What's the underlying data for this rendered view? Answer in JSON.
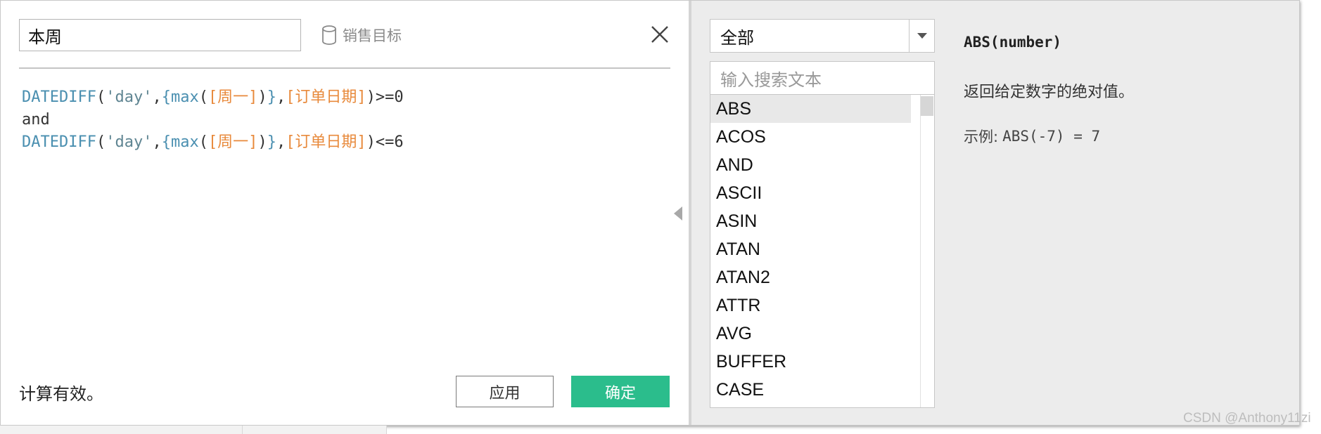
{
  "calc": {
    "name_value": "本周",
    "datasource_label": "销售目标",
    "status_text": "计算有效。",
    "apply_label": "应用",
    "ok_label": "确定",
    "formula": [
      [
        {
          "t": "DATEDIFF",
          "c": "fn"
        },
        {
          "t": "(",
          "c": "plain"
        },
        {
          "t": "'day'",
          "c": "str"
        },
        {
          "t": ",",
          "c": "plain"
        },
        {
          "t": "{max",
          "c": "fn"
        },
        {
          "t": "(",
          "c": "plain"
        },
        {
          "t": "[周一]",
          "c": "fld"
        },
        {
          "t": ")",
          "c": "plain"
        },
        {
          "t": "}",
          "c": "fn"
        },
        {
          "t": ",",
          "c": "plain"
        },
        {
          "t": "[订单日期]",
          "c": "fld"
        },
        {
          "t": ")>=0",
          "c": "plain"
        }
      ],
      [
        {
          "t": "and",
          "c": "plain"
        }
      ],
      [
        {
          "t": "DATEDIFF",
          "c": "fn"
        },
        {
          "t": "(",
          "c": "plain"
        },
        {
          "t": "'day'",
          "c": "str"
        },
        {
          "t": ",",
          "c": "plain"
        },
        {
          "t": "{max",
          "c": "fn"
        },
        {
          "t": "(",
          "c": "plain"
        },
        {
          "t": "[周一]",
          "c": "fld"
        },
        {
          "t": ")",
          "c": "plain"
        },
        {
          "t": "}",
          "c": "fn"
        },
        {
          "t": ",",
          "c": "plain"
        },
        {
          "t": "[订单日期]",
          "c": "fld"
        },
        {
          "t": ")<=6",
          "c": "plain"
        }
      ]
    ]
  },
  "functions": {
    "category_value": "全部",
    "search_placeholder": "输入搜索文本",
    "items": [
      "ABS",
      "ACOS",
      "AND",
      "ASCII",
      "ASIN",
      "ATAN",
      "ATAN2",
      "ATTR",
      "AVG",
      "BUFFER",
      "CASE"
    ],
    "selected_index": 0
  },
  "help": {
    "signature": "ABS(number)",
    "description": "返回给定数字的绝对值。",
    "example_label": "示例:",
    "example_code": "ABS(-7) = 7"
  },
  "watermark": "CSDN @Anthony11zi",
  "colors": {
    "accent_green": "#2bbd8c",
    "function_blue": "#4a8fb0",
    "field_orange": "#e88a3c"
  },
  "icons": {
    "datasource": "cylinder-icon",
    "close": "close-icon",
    "dropdown": "caret-down-icon",
    "collapse": "caret-left-icon"
  }
}
